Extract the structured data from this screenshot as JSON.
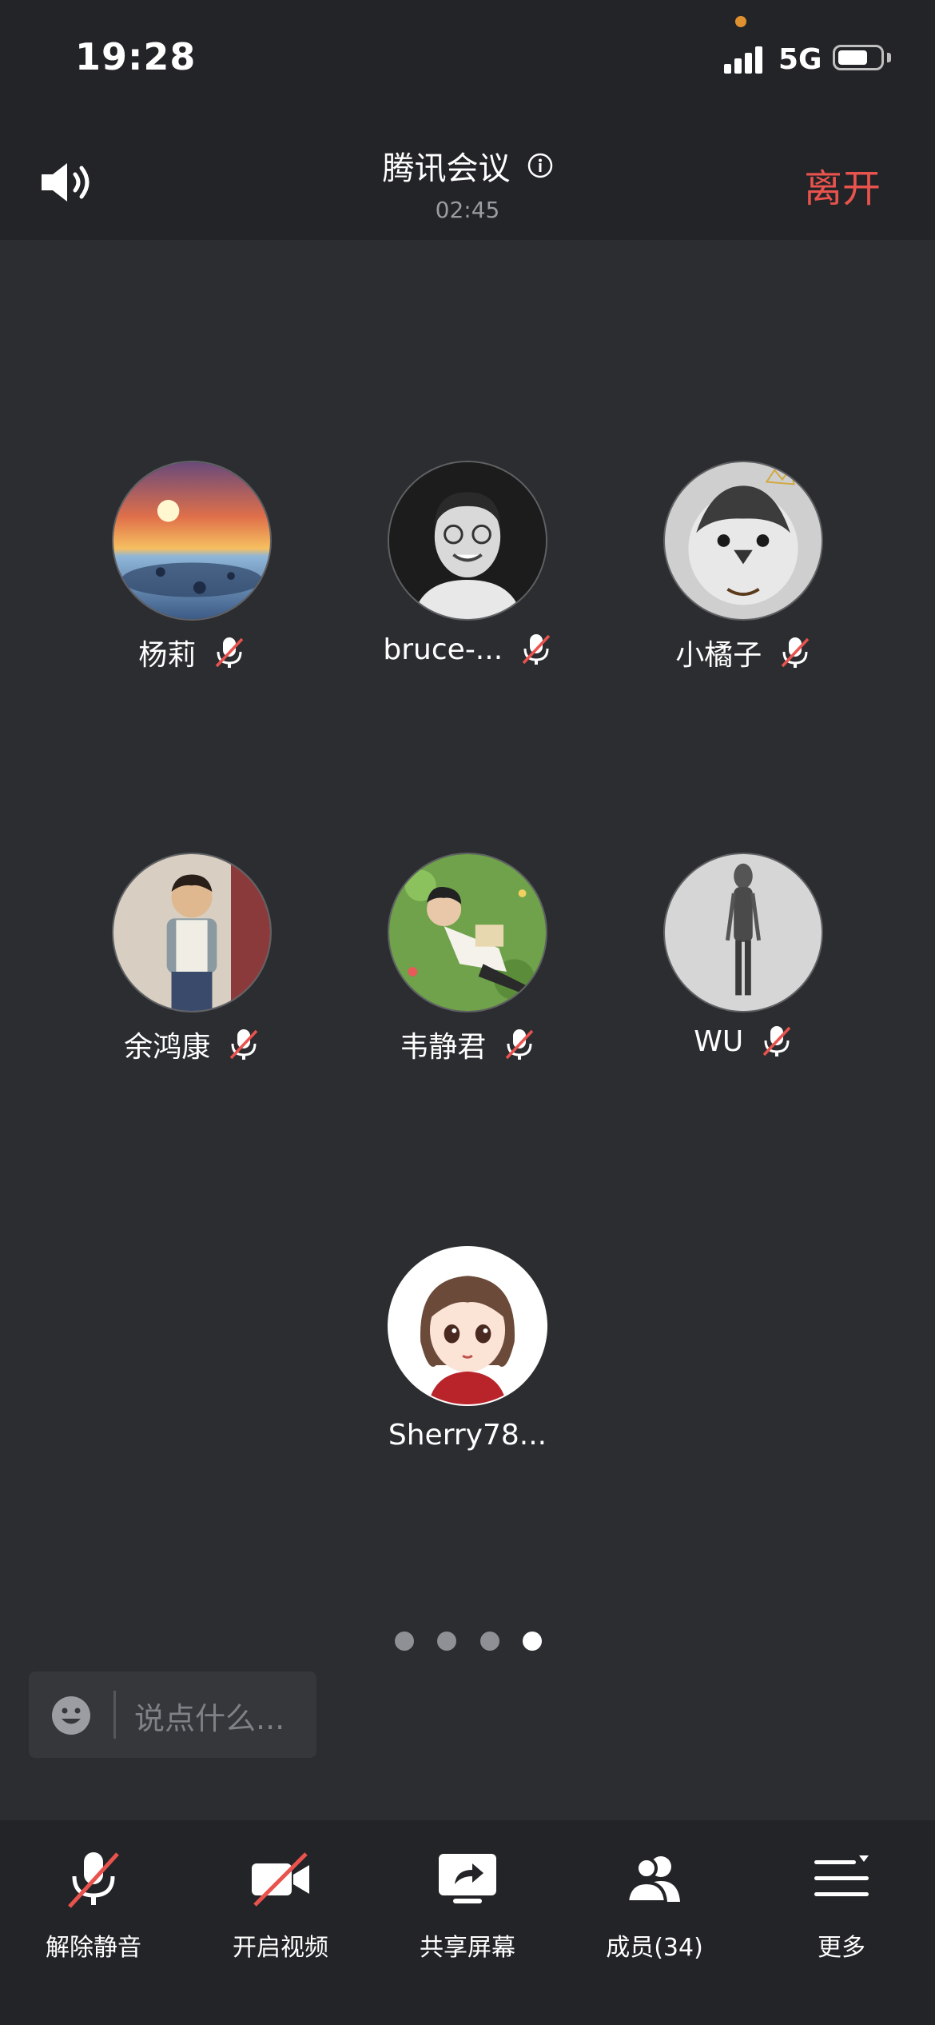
{
  "status_bar": {
    "time": "19:28",
    "network": "5G",
    "battery_level": 0.7
  },
  "header": {
    "title": "腾讯会议",
    "timer": "02:45",
    "leave_label": "离开"
  },
  "participants": [
    {
      "name": "杨莉",
      "muted": true
    },
    {
      "name": "bruce-...",
      "muted": true
    },
    {
      "name": "小橘子",
      "muted": true
    },
    {
      "name": "余鸿康",
      "muted": true
    },
    {
      "name": "韦静君",
      "muted": true
    },
    {
      "name": "WU",
      "muted": true
    },
    {
      "name": "Sherry78...",
      "muted": false
    }
  ],
  "pagination": {
    "pages": 4,
    "current": 4
  },
  "chat": {
    "placeholder": "说点什么..."
  },
  "toolbar": {
    "unmute_label": "解除静音",
    "video_label": "开启视频",
    "share_label": "共享屏幕",
    "members_label": "成员(34)",
    "more_label": "更多"
  },
  "colors": {
    "accent_red": "#e9534e",
    "background": "#2b2d30",
    "bar": "#232427"
  }
}
